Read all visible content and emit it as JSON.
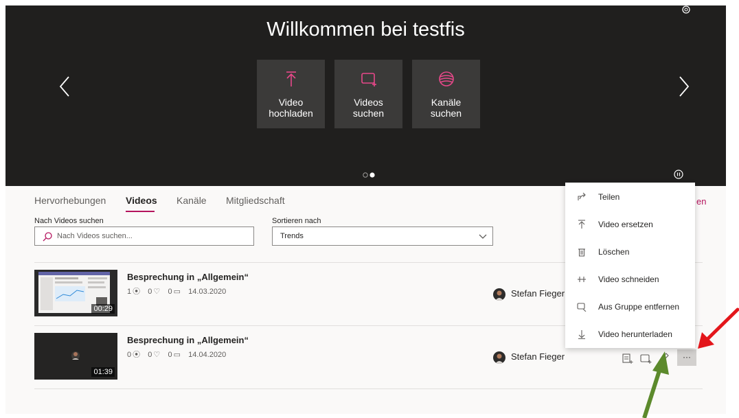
{
  "hero": {
    "title": "Willkommen bei testfis",
    "tiles": [
      {
        "line1": "Video",
        "line2": "hochladen",
        "icon": "upload-icon"
      },
      {
        "line1": "Videos",
        "line2": "suchen",
        "icon": "find-video-icon"
      },
      {
        "line1": "Kanäle",
        "line2": "suchen",
        "icon": "channels-icon"
      }
    ],
    "carousel_active_index": 1
  },
  "tabs": [
    {
      "label": "Hervorhebungen"
    },
    {
      "label": "Videos"
    },
    {
      "label": "Kanäle"
    },
    {
      "label": "Mitgliedschaft"
    }
  ],
  "tab_tail": "en",
  "filters": {
    "search_label": "Nach Videos suchen",
    "search_placeholder": "Nach Videos suchen...",
    "sort_label": "Sortieren nach",
    "sort_value": "Trends"
  },
  "videos": [
    {
      "title": "Besprechung in „Allgemein“",
      "views": "1",
      "likes": "0",
      "comments": "0",
      "date": "14.03.2020",
      "duration": "00:29",
      "author": "Stefan Fieger"
    },
    {
      "title": "Besprechung in „Allgemein“",
      "views": "0",
      "likes": "0",
      "comments": "0",
      "date": "14.04.2020",
      "duration": "01:39",
      "author": "Stefan Fieger"
    }
  ],
  "menu": [
    {
      "label": "Teilen",
      "icon": "share-icon"
    },
    {
      "label": "Video ersetzen",
      "icon": "replace-icon"
    },
    {
      "label": "Löschen",
      "icon": "trash-icon"
    },
    {
      "label": "Video schneiden",
      "icon": "trim-icon"
    },
    {
      "label": "Aus Gruppe entfernen",
      "icon": "remove-from-group-icon"
    },
    {
      "label": "Video herunterladen",
      "icon": "download-icon"
    }
  ],
  "more_label": "···",
  "colors": {
    "accent": "#b4135d",
    "hero_bg": "#201f1e",
    "tile_bg": "#3b3a39",
    "red_arrow": "#e3161b",
    "green_arrow": "#5c8a2c"
  }
}
